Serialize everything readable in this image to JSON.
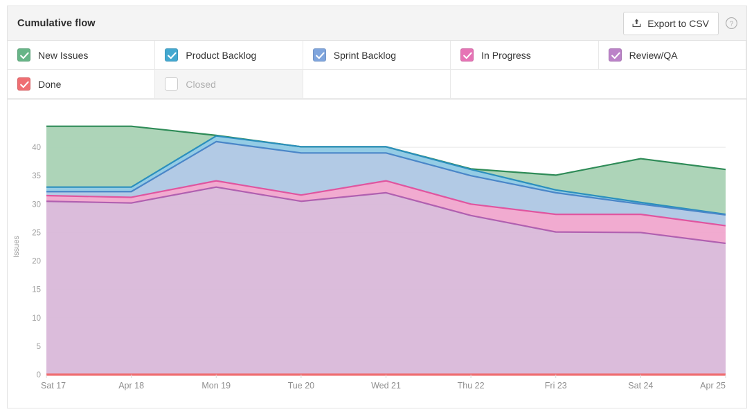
{
  "header": {
    "title": "Cumulative flow",
    "export_label": "Export to CSV",
    "export_icon": "upload-icon",
    "help_icon": "question-circle-icon"
  },
  "legend": {
    "items": [
      {
        "label": "New Issues",
        "checked": true,
        "color": "#67b587",
        "enabled": true
      },
      {
        "label": "Product Backlog",
        "checked": true,
        "color": "#43a8d0",
        "enabled": true
      },
      {
        "label": "Sprint Backlog",
        "checked": true,
        "color": "#7fa5dd",
        "enabled": true
      },
      {
        "label": "In Progress",
        "checked": true,
        "color": "#e673b5",
        "enabled": true
      },
      {
        "label": "Review/QA",
        "checked": true,
        "color": "#bb82c8",
        "enabled": true
      },
      {
        "label": "Done",
        "checked": true,
        "color": "#ef6e72",
        "enabled": true
      },
      {
        "label": "Closed",
        "checked": false,
        "color": "#ffffff",
        "enabled": false
      }
    ]
  },
  "chart_data": {
    "type": "area",
    "title": "Cumulative flow",
    "xlabel": "",
    "ylabel": "Issues",
    "ylim": [
      0,
      45
    ],
    "yticks": [
      0,
      5,
      10,
      15,
      20,
      25,
      30,
      35,
      40
    ],
    "grid": true,
    "legend_position": "top",
    "stacked": true,
    "categories": [
      "Sat 17",
      "Apr 18",
      "Mon 19",
      "Tue 20",
      "Wed 21",
      "Thu 22",
      "Fri 23",
      "Sat 24",
      "Apr 25"
    ],
    "series": [
      {
        "name": "Done",
        "color": "#ef6e72",
        "fill": "#f6b9bb",
        "values": [
          0,
          0,
          0,
          0,
          0,
          0,
          0,
          0,
          0
        ]
      },
      {
        "name": "Review/QA",
        "color": "#b060b0",
        "fill": "#d9b8d9",
        "values": [
          30.5,
          30.2,
          33.0,
          30.5,
          32.0,
          28.0,
          25.1,
          25.0,
          23.1
        ]
      },
      {
        "name": "In Progress",
        "color": "#e0559f",
        "fill": "#f0a6cd",
        "values": [
          31.5,
          31.2,
          34.1,
          31.6,
          34.1,
          30.0,
          28.2,
          28.2,
          26.2
        ]
      },
      {
        "name": "Sprint Backlog",
        "color": "#4a86c8",
        "fill": "#aec7e4",
        "values": [
          32.2,
          32.2,
          41.0,
          39.0,
          39.0,
          35.0,
          32.0,
          30.0,
          28.1
        ]
      },
      {
        "name": "Product Backlog",
        "color": "#2b8fbd",
        "fill": "#8ec9e4",
        "values": [
          33.0,
          33.0,
          42.0,
          40.1,
          40.1,
          36.1,
          32.5,
          30.3,
          28.2
        ]
      },
      {
        "name": "New Issues",
        "color": "#2e8b57",
        "fill": "#a9d2b4",
        "values": [
          43.7,
          43.7,
          42.1,
          40.1,
          40.1,
          36.2,
          35.1,
          38.0,
          36.1
        ]
      }
    ]
  }
}
